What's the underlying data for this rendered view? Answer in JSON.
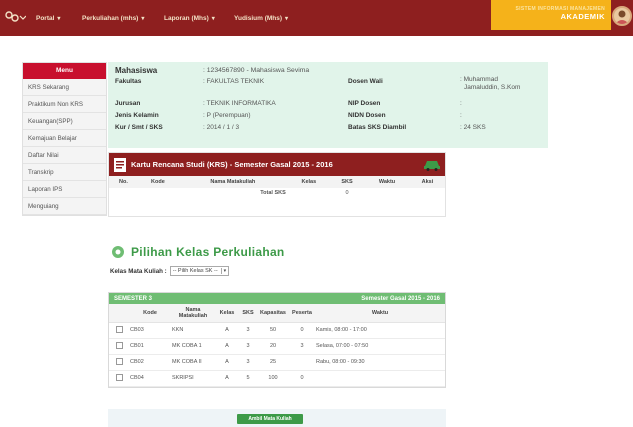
{
  "nav": {
    "items": [
      {
        "label": "Portal",
        "caret": "▾"
      },
      {
        "label": "Perkuliahan (mhs)",
        "caret": "▾"
      },
      {
        "label": "Laporan (Mhs)",
        "caret": "▾"
      },
      {
        "label": "Yudisium (Mhs)",
        "caret": "▾"
      }
    ],
    "sia_top": "SISTEM INFORMASI MANAJEMEN",
    "sia_bottom": "AKADEMIK"
  },
  "menu": {
    "header": "Menu",
    "items": [
      "KRS Sekarang",
      "Praktikum Non KRS",
      "Keuangan(SPP)",
      "Kemajuan Belajar",
      "Daftar Nilai",
      "Transkrip",
      "Laporan IPS",
      "Menguiang"
    ]
  },
  "student": {
    "mahasiswa_label": "Mahasiswa",
    "mahasiswa_value": ": 1234567890 - Mahasiswa Sevima",
    "fakultas_label": "Fakultas",
    "fakultas_value": ": FAKULTAS TEKNIK",
    "jurusan_label": "Jurusan",
    "jurusan_value": ": TEKNIK INFORMATIKA",
    "jk_label": "Jenis Kelamin",
    "jk_value": ": P (Perempuan)",
    "kur_label": "Kur / Smt / SKS",
    "kur_value": ": 2014 / 1 / 3",
    "dosen_wali_label": "Dosen Wali",
    "dosen_wali_value_1": ": Muhammad",
    "dosen_wali_value_2": "Jamaluddin, S.Kom",
    "nip_label": "NIP Dosen",
    "nip_value": ":",
    "nidn_label": "NIDN Dosen",
    "nidn_value": ":",
    "batas_label": "Batas SKS Diambil",
    "batas_value": ": 24 SKS"
  },
  "krs": {
    "title": "Kartu Rencana Studi (KRS) - Semester Gasal 2015 - 2016",
    "headers": [
      "No.",
      "Kode",
      "Nama Matakuliah",
      "Kelas",
      "SKS",
      "Waktu",
      "Aksi"
    ],
    "total_label": "Total SKS",
    "total_value": "0"
  },
  "pilihan": {
    "title": "Pilihan Kelas Perkuliahan",
    "kelas_label": "Kelas Mata Kuliah :",
    "select_value": "-- Pilih Kelas SK --"
  },
  "courses": {
    "semester": "SEMESTER 3",
    "period": "Semester Gasal 2015 - 2016",
    "headers": [
      "",
      "Kode",
      "Nama Matakuliah",
      "Kelas",
      "SKS",
      "Kapasitas",
      "Peserta",
      "Waktu"
    ],
    "rows": [
      {
        "kode": "CB03",
        "nama": "KKN",
        "kelas": "A",
        "sks": "3",
        "kap": "50",
        "peserta": "0",
        "waktu": "Kamis, 08:00 - 17:00"
      },
      {
        "kode": "CB01",
        "nama": "MK COBA 1",
        "kelas": "A",
        "sks": "3",
        "kap": "20",
        "peserta": "3",
        "waktu": "Selasa, 07:00 - 07:50"
      },
      {
        "kode": "CB02",
        "nama": "MK COBA II",
        "kelas": "A",
        "sks": "3",
        "kap": "25",
        "peserta": "",
        "waktu": "Rabu, 08:00 - 09:30"
      },
      {
        "kode": "CB04",
        "nama": "SKRIPSI",
        "kelas": "A",
        "sks": "5",
        "kap": "100",
        "peserta": "0",
        "waktu": ""
      }
    ],
    "button": "Ambil Mata Kuliah"
  },
  "colors": {
    "nav_bg": "#8e1f1f",
    "accent_red": "#c8102e",
    "green": "#3d9a48",
    "sia_yellow": "#f5b21a"
  }
}
